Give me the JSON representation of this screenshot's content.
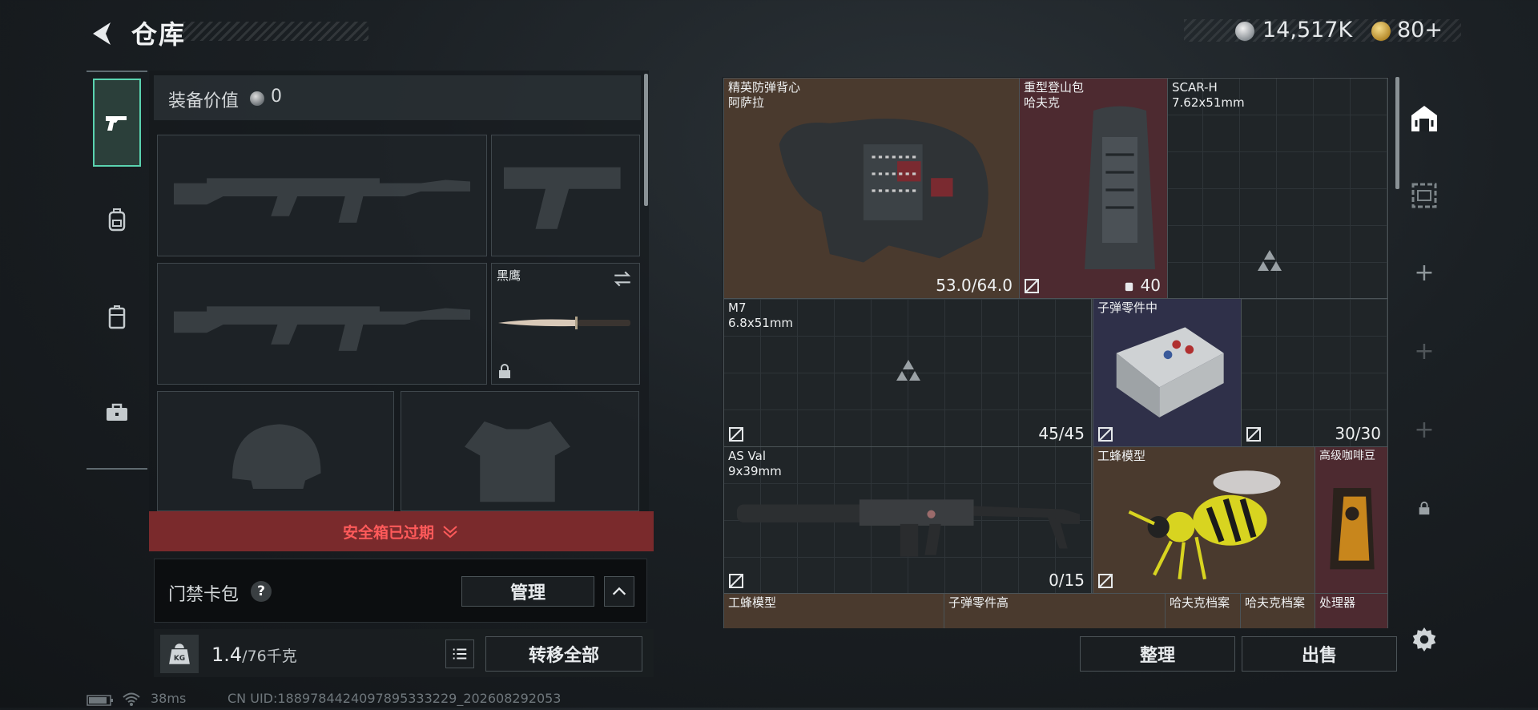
{
  "header": {
    "title": "仓库",
    "currency_silver": "14,517K",
    "currency_gold": "80+"
  },
  "loadout": {
    "equip_value_label": "装备价值",
    "equip_value": "0",
    "melee_name": "黑鹰",
    "safe_box_status": "安全箱已过期",
    "access_card_label": "门禁卡包",
    "help": "?",
    "manage_label": "管理",
    "weight_value": "1.4",
    "weight_unit": "/76千克",
    "transfer_label": "转移全部"
  },
  "stash": {
    "items": [
      {
        "name": "精英防弹背心",
        "sub": "阿萨拉",
        "count": "53.0/64.0"
      },
      {
        "name": "重型登山包",
        "sub": "哈夫克",
        "count": "40"
      },
      {
        "name": "SCAR-H",
        "sub": "7.62x51mm",
        "count": ""
      },
      {
        "name": "M7",
        "sub": "6.8x51mm",
        "count": "45/45"
      },
      {
        "name": "子弹零件中",
        "sub": "",
        "count": ""
      },
      {
        "name": "",
        "sub": "",
        "count": "30/30"
      },
      {
        "name": "AS Val",
        "sub": "9x39mm",
        "count": "0/15"
      },
      {
        "name": "工蜂模型",
        "sub": "",
        "count": ""
      },
      {
        "name": "高级咖啡豆",
        "sub": "",
        "count": ""
      },
      {
        "name": "工蜂模型",
        "sub": "",
        "count": ""
      },
      {
        "name": "子弹零件高",
        "sub": "",
        "count": ""
      },
      {
        "name": "哈夫克档案",
        "sub": "",
        "count": ""
      },
      {
        "name": "哈夫克档案",
        "sub": "",
        "count": ""
      },
      {
        "name": "处理器",
        "sub": "",
        "count": ""
      }
    ],
    "sort_label": "整理",
    "sell_label": "出售"
  },
  "footer": {
    "ping": "38ms",
    "uid": "CN UID:1889784424097895333229_202608292053"
  },
  "colors": {
    "accent": "#5ad3b0",
    "danger": "#ff5a5a",
    "danger_bg": "#7a2a2c",
    "rarity_brown": "#4a3a2e",
    "rarity_red": "#4d2a30",
    "rarity_purple": "#2f3049"
  },
  "icons": [
    "back-arrow-icon",
    "pistol-icon",
    "backpack-icon",
    "case-icon",
    "toolbox-icon",
    "lock-icon",
    "swap-icon",
    "chevron-down-icon",
    "chevron-up-icon",
    "list-icon",
    "weight-icon",
    "home-icon",
    "frame-icon",
    "plus-icon",
    "gear-icon",
    "battery-icon",
    "wifi-icon",
    "no-insurance-icon",
    "weapon-placeholder-icon"
  ]
}
